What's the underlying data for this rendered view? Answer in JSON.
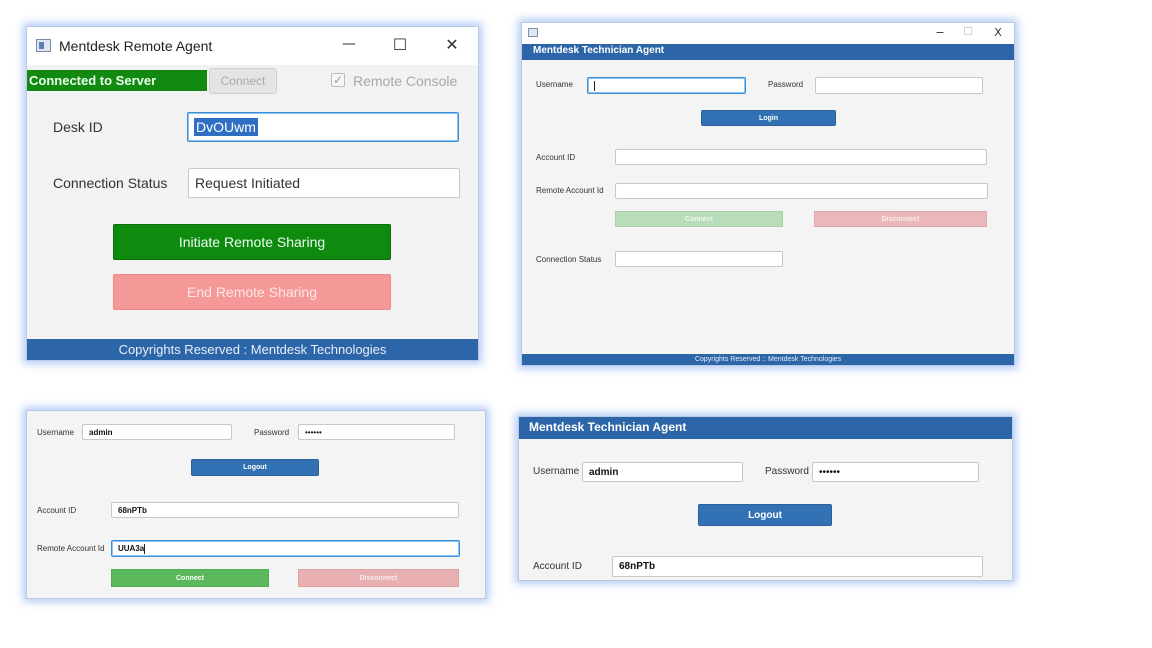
{
  "remote_agent": {
    "title": "Mentdesk Remote Agent",
    "controls": {
      "minimize": "—",
      "maximize": "☐",
      "close": "✕"
    },
    "status_label": "Connected to Server",
    "connect_label": "Connect",
    "remote_console_label": "Remote Console",
    "remote_console_checked": true,
    "desk_id_label": "Desk ID",
    "desk_id_value": "DvOUwm",
    "connection_status_label": "Connection Status",
    "connection_status_value": "Request Initiated",
    "initiate_label": "Initiate Remote Sharing",
    "end_label": "End Remote Sharing",
    "footer": "Copyrights Reserved : Mentdesk Technologies",
    "colors": {
      "connected": "#128a12",
      "initiate": "#0e8a0e",
      "end": "#f59898",
      "footer": "#2c66a9"
    }
  },
  "technician_window": {
    "controls": {
      "minimize": "−",
      "maximize": "☐",
      "close": "X"
    },
    "header": "Mentdesk Technician Agent",
    "username_label": "Username",
    "username_value": "",
    "password_label": "Password",
    "password_value": "",
    "login_label": "Login",
    "account_id_label": "Account ID",
    "account_id_value": "",
    "remote_account_label": "Remote Account Id",
    "remote_account_value": "",
    "connect_label": "Connect",
    "disconnect_label": "Disconnect",
    "connection_status_label": "Connection Status",
    "connection_status_value": "",
    "footer": "Copyrights Reserved :: Mentdesk Technologies"
  },
  "logged_in_panel": {
    "username_label": "Username",
    "username_value": "admin",
    "password_label": "Password",
    "password_value": "••••••",
    "logout_label": "Logout",
    "account_id_label": "Account ID",
    "account_id_value": "68nPTb",
    "remote_account_label": "Remote Account Id",
    "remote_account_value": "UUA3a",
    "connect_label": "Connect",
    "disconnect_label": "Disconnect",
    "colors": {
      "connect": "#5cb85c",
      "disconnect": "#e8b0b0"
    }
  },
  "zoomed_panel": {
    "header": "Mentdesk Technician Agent",
    "username_label": "Username",
    "username_value": "admin",
    "password_label": "Password",
    "password_value": "••••••",
    "logout_label": "Logout",
    "account_id_label": "Account ID",
    "account_id_value": "68nPTb"
  }
}
